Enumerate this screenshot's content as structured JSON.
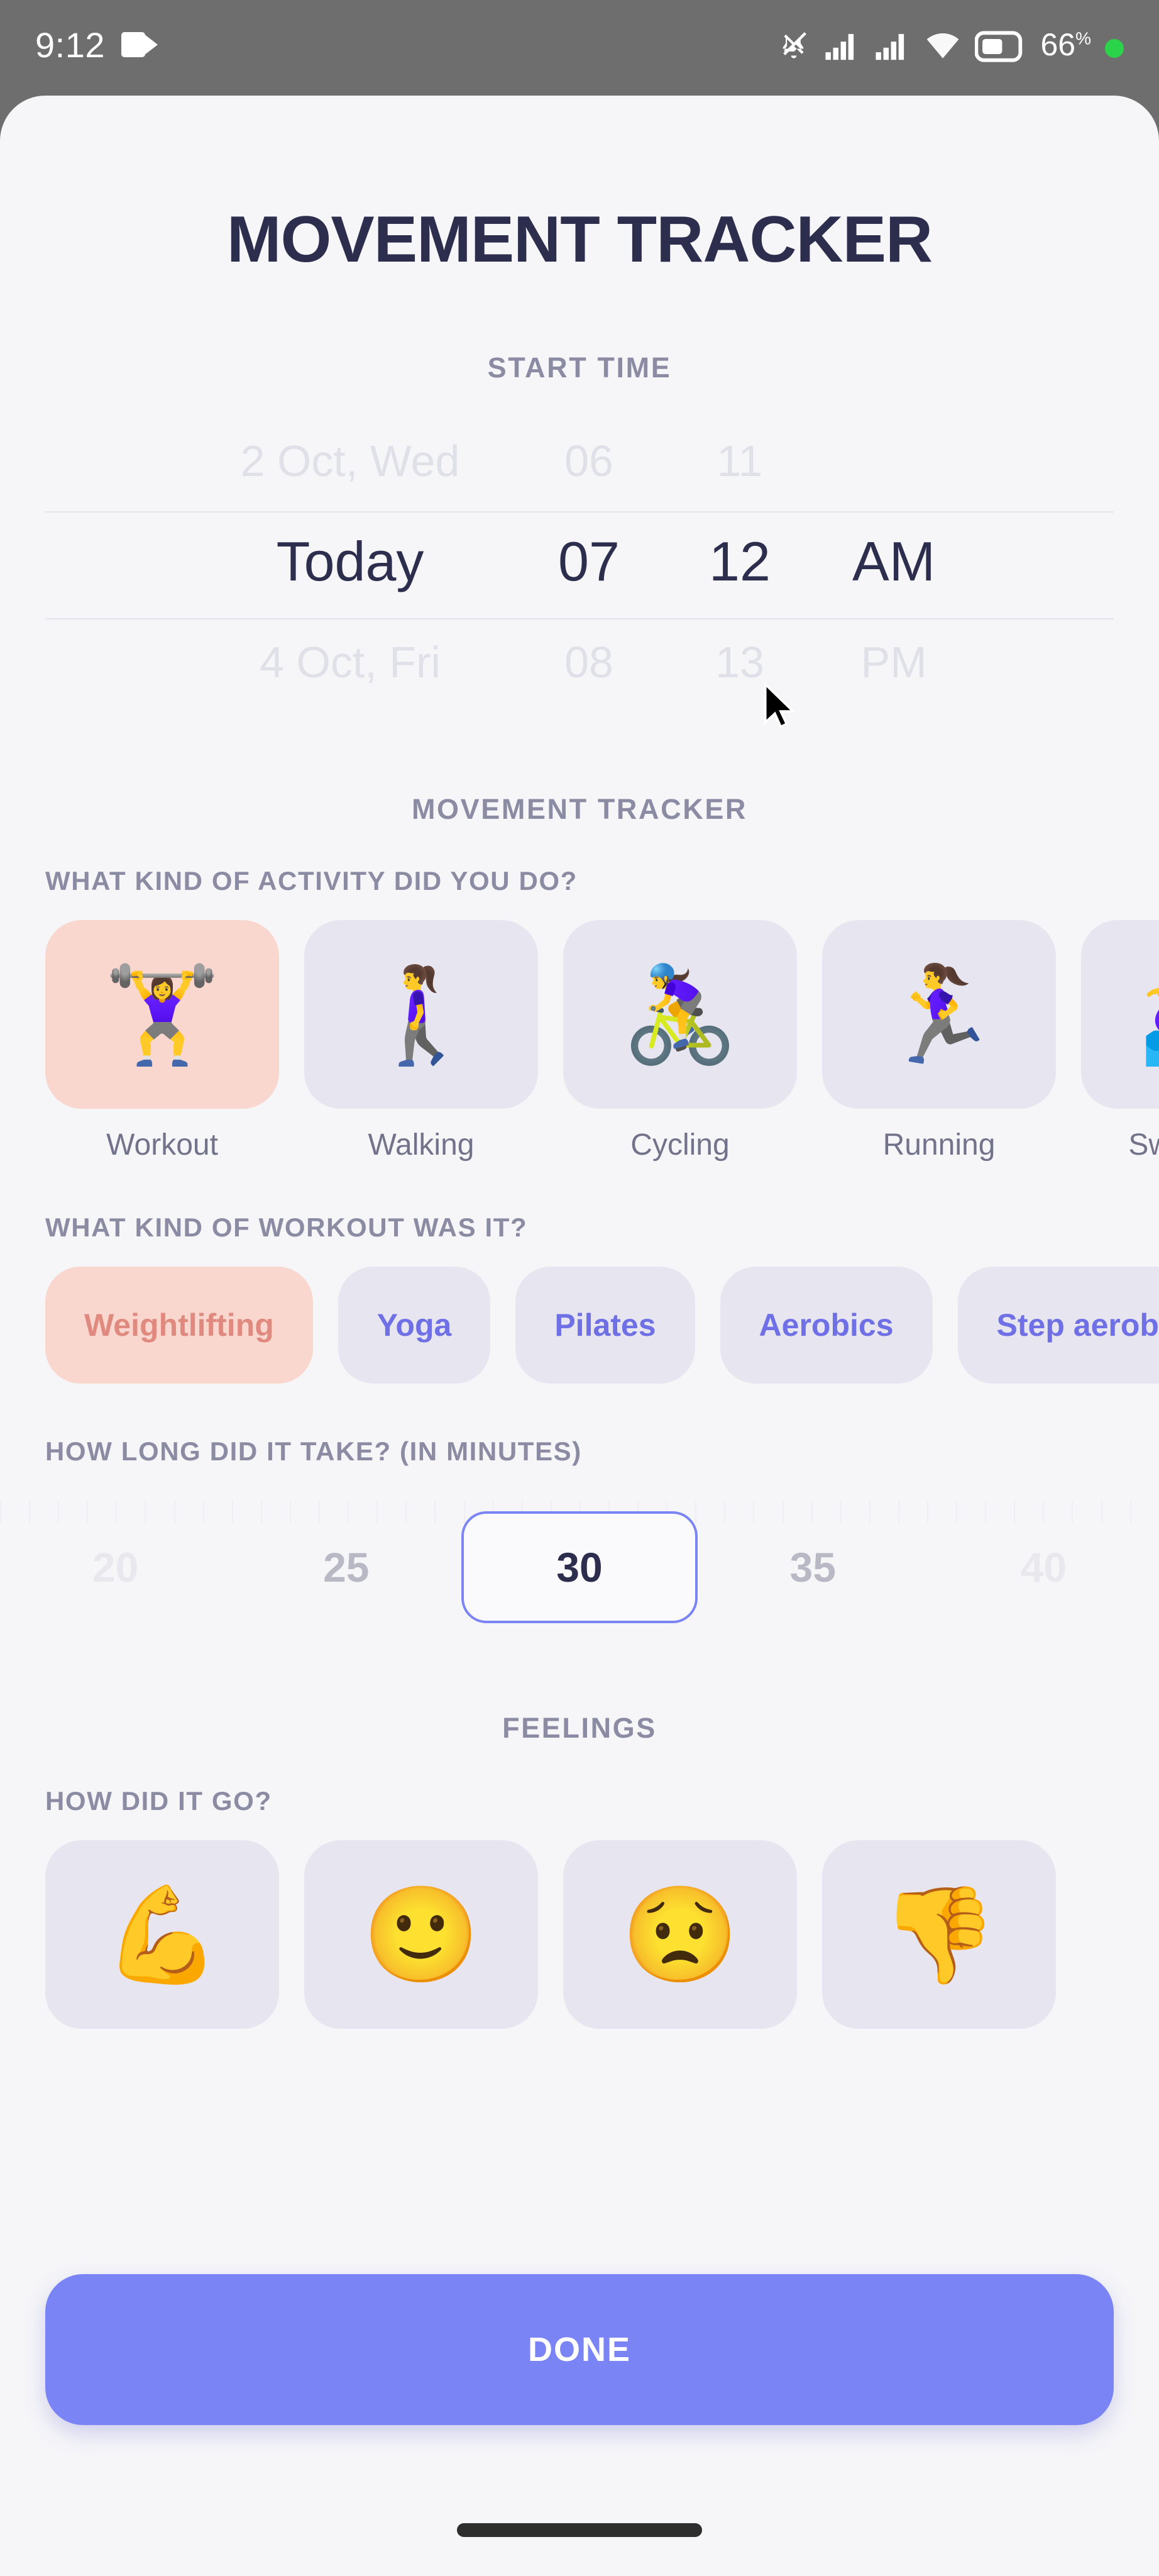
{
  "status_bar": {
    "time": "9:12",
    "video_icon": "video-camera-icon",
    "mute_icon": "bell-muted-icon",
    "signal_icon_1": "signal-bars-icon",
    "signal_icon_2": "signal-bars-icon",
    "wifi_icon": "wifi-icon",
    "battery_icon": "battery-icon",
    "battery_percent": "66",
    "battery_unit": "%",
    "recording_dot": "green-recording-dot"
  },
  "page_title": "MOVEMENT TRACKER",
  "start_time": {
    "header": "START TIME",
    "rows": {
      "above": {
        "date": "2 Oct, Wed",
        "hour": "06",
        "minute": "11",
        "meridiem": ""
      },
      "selected": {
        "date": "Today",
        "hour": "07",
        "minute": "12",
        "meridiem": "AM"
      },
      "below": {
        "date": "4 Oct, Fri",
        "hour": "08",
        "minute": "13",
        "meridiem": "PM"
      }
    }
  },
  "movement_tracker": {
    "header": "MOVEMENT TRACKER",
    "activity_label": "WHAT KIND OF ACTIVITY DID YOU DO?",
    "activities": [
      {
        "label": "Workout",
        "emoji": "🏋️‍♀️",
        "icon_name": "weightlifting-emoji",
        "selected": true
      },
      {
        "label": "Walking",
        "emoji": "🚶‍♀️",
        "icon_name": "walking-emoji",
        "selected": false
      },
      {
        "label": "Cycling",
        "emoji": "🚴‍♀️",
        "icon_name": "cycling-emoji",
        "selected": false
      },
      {
        "label": "Running",
        "emoji": "🏃‍♀️",
        "icon_name": "running-emoji",
        "selected": false
      },
      {
        "label": "Swimming",
        "emoji": "🏊‍♀️",
        "icon_name": "swimming-emoji",
        "selected": false
      }
    ],
    "workout_label": "WHAT KIND OF WORKOUT WAS IT?",
    "workout_types": [
      {
        "label": "Weightlifting",
        "selected": true
      },
      {
        "label": "Yoga",
        "selected": false
      },
      {
        "label": "Pilates",
        "selected": false
      },
      {
        "label": "Aerobics",
        "selected": false
      },
      {
        "label": "Step aerobics",
        "selected": false
      }
    ],
    "duration_label": "HOW LONG DID IT TAKE? (IN MINUTES)",
    "duration_values": [
      "20",
      "25",
      "30",
      "35",
      "40"
    ],
    "duration_selected": "30"
  },
  "feelings": {
    "header": "FEELINGS",
    "question_label": "HOW DID IT GO?",
    "options": [
      {
        "emoji": "💪",
        "icon_name": "flexed-biceps-emoji",
        "selected": false
      },
      {
        "emoji": "🙂",
        "icon_name": "slightly-smiling-face-emoji",
        "selected": false
      },
      {
        "emoji": "😟",
        "icon_name": "worried-face-emoji",
        "selected": false
      },
      {
        "emoji": "👎",
        "icon_name": "thumbs-down-emoji",
        "selected": false
      }
    ]
  },
  "footer": {
    "done_label": "DONE"
  },
  "colors": {
    "accent": "#7b84f4",
    "selected_card_bg": "#f9d6ce",
    "card_bg": "#e7e6f0",
    "chip_text": "#6f6fe6",
    "chip_selected_text": "#e08a7f",
    "title_text": "#2d2d4e",
    "label_text": "#8b8ba3",
    "surface_bg": "#f6f6f9",
    "status_bar_bg": "#6e6e6e"
  }
}
